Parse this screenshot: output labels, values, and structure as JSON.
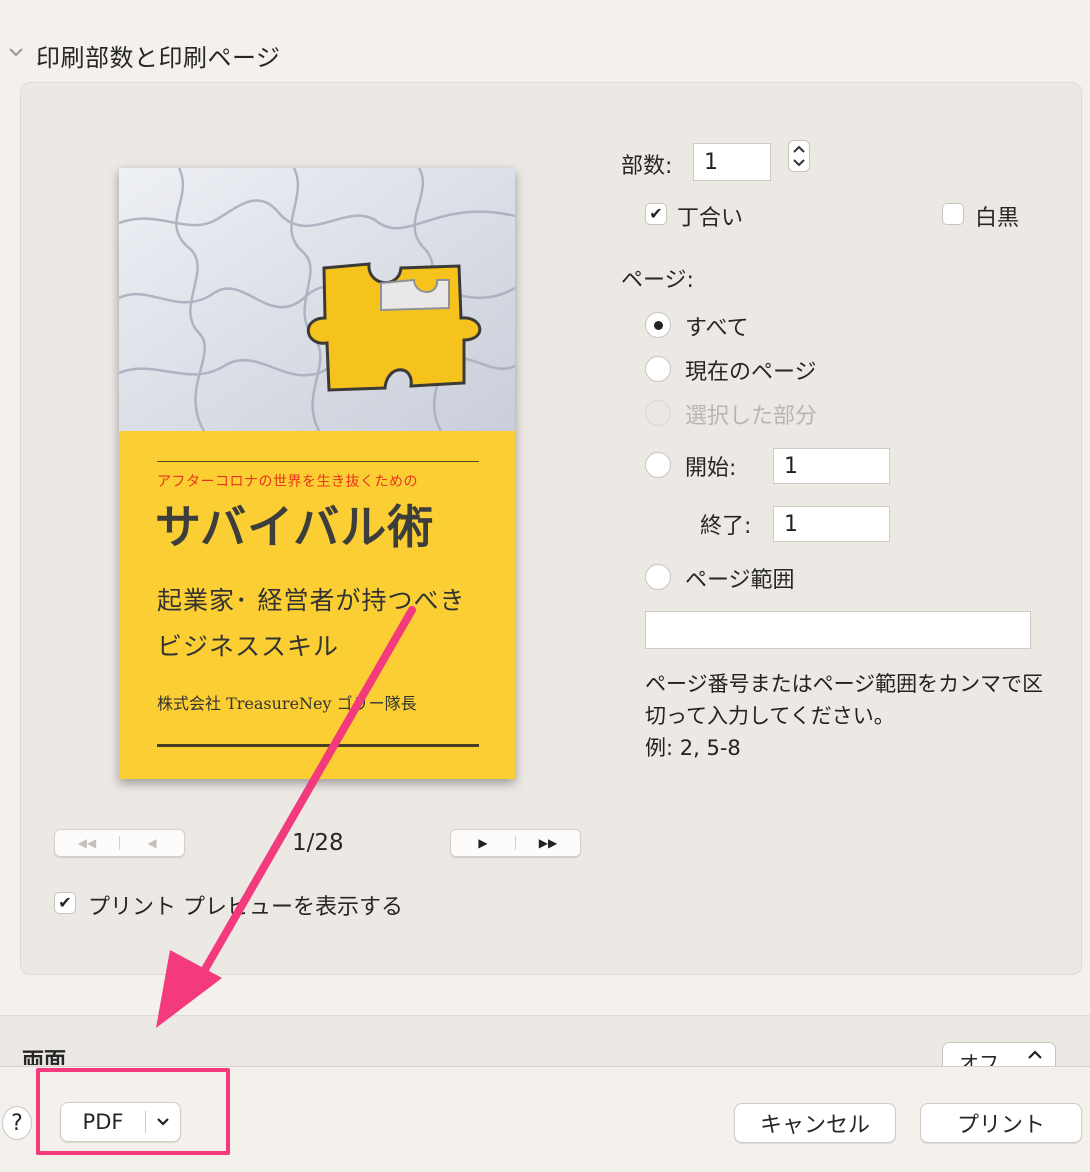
{
  "section": {
    "title": "印刷部数と印刷ページ"
  },
  "preview": {
    "cover": {
      "subtitle": "アフターコロナの世界を生き抜くための",
      "title": "サバイバル術",
      "description": "起業家･ 経営者が持つべきビジネススキル",
      "author": "株式会社 TreasureNey ゴリー隊長"
    },
    "page_counter": "1/28",
    "nav_left": {
      "first": "◀◀",
      "prev": "◀"
    },
    "nav_right": {
      "next": "▶",
      "last": "▶▶"
    },
    "show_preview_label": "プリント プレビューを表示する",
    "show_preview_checked": true
  },
  "copies": {
    "label": "部数:",
    "value": "1",
    "collate_label": "丁合い",
    "collate_checked": true,
    "bw_label": "白黒",
    "bw_checked": false
  },
  "pages": {
    "label": "ページ:",
    "options": [
      {
        "label": "すべて",
        "selected": true,
        "disabled": false
      },
      {
        "label": "現在のページ",
        "selected": false,
        "disabled": false
      },
      {
        "label": "選択した部分",
        "selected": false,
        "disabled": true
      },
      {
        "label": "開始:",
        "selected": false,
        "disabled": false
      },
      {
        "label": "ページ範囲",
        "selected": false,
        "disabled": false
      }
    ],
    "from_value": "1",
    "to_label": "終了:",
    "to_value": "1",
    "range_value": "",
    "help": "ページ番号またはページ範囲をカンマで区切って入力してください。",
    "example": "例: 2, 5-8"
  },
  "duplex": {
    "label": "両面",
    "value": "オフ"
  },
  "footer": {
    "help": "?",
    "pdf": "PDF",
    "cancel": "キャンセル",
    "print": "プリント"
  },
  "annotation": {
    "color": "#f23a7c"
  }
}
